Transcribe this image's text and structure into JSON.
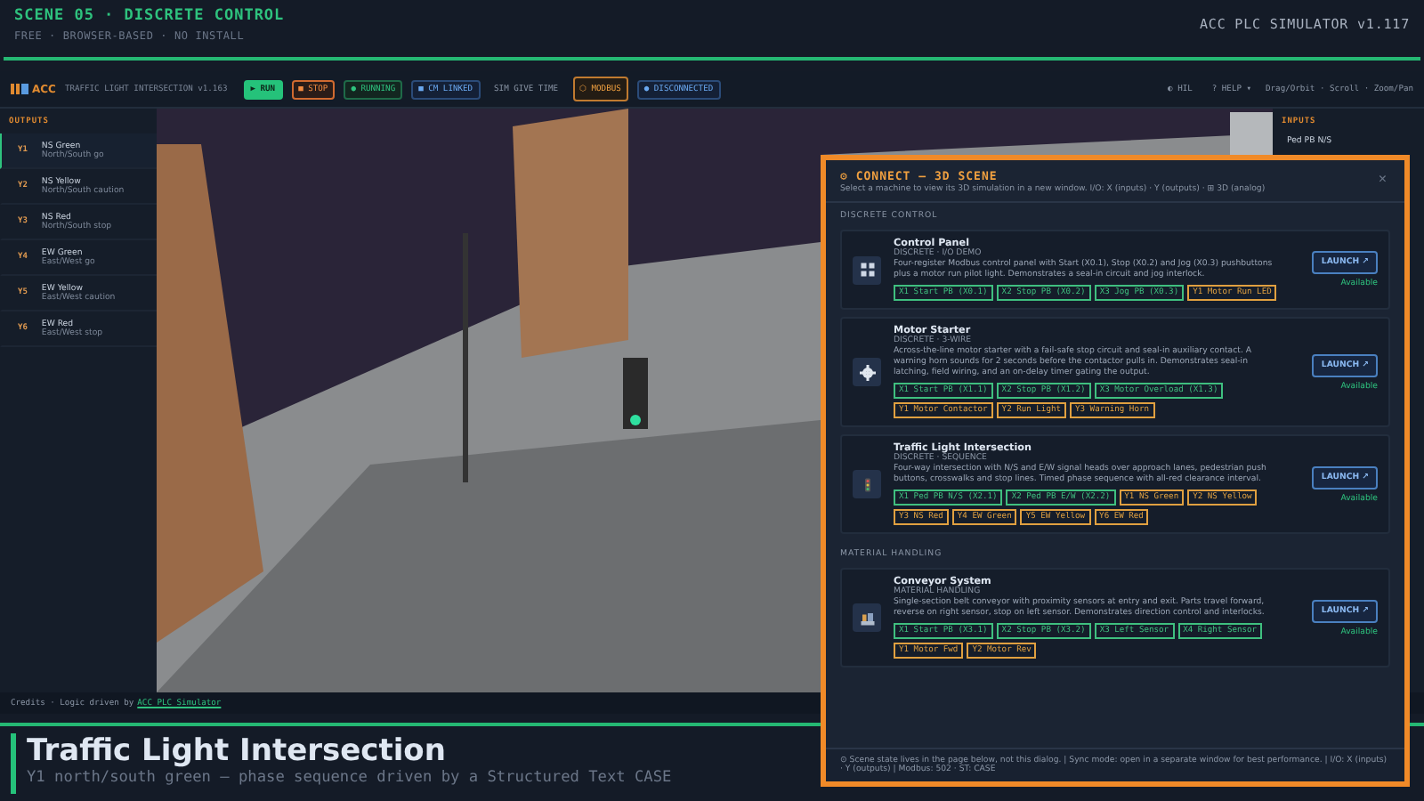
{
  "header": {
    "title": "SCENE 05 · DISCRETE CONTROL",
    "subtitle": "FREE · BROWSER-BASED · NO INSTALL",
    "product": "ACC PLC SIMULATOR  v1.117"
  },
  "toolbar": {
    "logo": "ACC",
    "scene_name": "TRAFFIC LIGHT INTERSECTION v1.163",
    "buttons": [
      {
        "kind": "primary",
        "label": "▶ RUN"
      },
      {
        "kind": "danger",
        "label": "■ STOP"
      },
      {
        "kind": "status",
        "label": "● RUNNING"
      },
      {
        "kind": "link",
        "label": "■ CM LINKED"
      },
      {
        "kind": "plain",
        "label": "SIM GIVE TIME"
      },
      {
        "kind": "warn",
        "label": "⬡ MODBUS"
      },
      {
        "kind": "link",
        "label": "● DISCONNECTED"
      }
    ],
    "right_buttons": [
      {
        "kind": "plain",
        "label": "◐ HIL"
      },
      {
        "kind": "plain",
        "label": "? HELP ▾"
      }
    ],
    "hint": "Drag/Orbit · Scroll · Zoom/Pan"
  },
  "outputs": {
    "title": "OUTPUTS",
    "items": [
      {
        "tag": "Y1",
        "name": "NS Green",
        "note": "North/South go",
        "selected": true
      },
      {
        "tag": "Y2",
        "name": "NS Yellow",
        "note": "North/South caution",
        "selected": false
      },
      {
        "tag": "Y3",
        "name": "NS Red",
        "note": "North/South stop",
        "selected": false
      },
      {
        "tag": "Y4",
        "name": "EW Green",
        "note": "East/West go",
        "selected": false
      },
      {
        "tag": "Y5",
        "name": "EW Yellow",
        "note": "East/West caution",
        "selected": false
      },
      {
        "tag": "Y6",
        "name": "EW Red",
        "note": "East/West stop",
        "selected": false
      }
    ]
  },
  "inputs": {
    "title": "INPUTS",
    "items": [
      "Ped PB N/S"
    ]
  },
  "credits": {
    "text": "Credits · Logic driven by",
    "link": "ACC PLC Simulator"
  },
  "scene_info": {
    "title": "Traffic Light Intersection",
    "subtitle": "Y1 north/south green — phase sequence driven by a Structured Text CASE"
  },
  "dialog": {
    "title": "⚙ CONNECT — 3D SCENE",
    "subtitle": "Select a machine to view its 3D simulation in a new window. I/O: X (inputs) · Y (outputs) · ⊞ 3D (analog)",
    "close": "×",
    "sections": [
      {
        "title": "DISCRETE CONTROL",
        "cards": [
          {
            "kind": "panel",
            "title": "Control Panel",
            "subtitle": "DISCRETE · I/O DEMO",
            "description": "Four-register Modbus control panel with Start (X0.1), Stop (X0.2) and Jog (X0.3) pushbuttons plus a motor run pilot light. Demonstrates a seal-in circuit and jog interlock.",
            "tags": [
              {
                "label": "X1 Start PB (X0.1)",
                "color": "#3fbf7f"
              },
              {
                "label": "X2 Stop PB (X0.2)",
                "color": "#3fbf7f"
              },
              {
                "label": "X3 Jog PB (X0.3)",
                "color": "#3fbf7f"
              },
              {
                "label": "Y1 Motor Run LED",
                "color": "#e0a040"
              }
            ],
            "button": "LAUNCH ↗",
            "status": "Available"
          },
          {
            "kind": "gear",
            "title": "Motor Starter",
            "subtitle": "DISCRETE · 3-WIRE",
            "description": "Across-the-line motor starter with a fail-safe stop circuit and seal-in auxiliary contact. A warning horn sounds for 2 seconds before the contactor pulls in. Demonstrates seal-in latching, field wiring, and an on-delay timer gating the output.",
            "tags": [
              {
                "label": "X1 Start PB (X1.1)",
                "color": "#3fbf7f"
              },
              {
                "label": "X2 Stop PB (X1.2)",
                "color": "#3fbf7f"
              },
              {
                "label": "X3 Motor Overload (X1.3)",
                "color": "#3fbf7f"
              },
              {
                "label": "Y1 Motor Contactor",
                "color": "#e0a040"
              },
              {
                "label": "Y2 Run Light",
                "color": "#e0a040"
              },
              {
                "label": "Y3 Warning Horn",
                "color": "#e0a040"
              }
            ],
            "button": "LAUNCH ↗",
            "status": "Available"
          },
          {
            "kind": "light",
            "title": "Traffic Light Intersection",
            "subtitle": "DISCRETE · SEQUENCE",
            "description": "Four-way intersection with N/S and E/W signal heads over approach lanes, pedestrian push buttons, crosswalks and stop lines. Timed phase sequence with all-red clearance interval.",
            "tags": [
              {
                "label": "X1 Ped PB N/S (X2.1)",
                "color": "#3fbf7f"
              },
              {
                "label": "X2 Ped PB E/W (X2.2)",
                "color": "#3fbf7f"
              },
              {
                "label": "Y1 NS Green",
                "color": "#e0a040"
              },
              {
                "label": "Y2 NS Yellow",
                "color": "#e0a040"
              },
              {
                "label": "Y3 NS Red",
                "color": "#e0a040"
              },
              {
                "label": "Y4 EW Green",
                "color": "#e0a040"
              },
              {
                "label": "Y5 EW Yellow",
                "color": "#e0a040"
              },
              {
                "label": "Y6 EW Red",
                "color": "#e0a040"
              }
            ],
            "button": "LAUNCH ↗",
            "status": "Available"
          }
        ]
      },
      {
        "title": "MATERIAL HANDLING",
        "cards": [
          {
            "kind": "conveyor",
            "title": "Conveyor System",
            "subtitle": "MATERIAL HANDLING",
            "description": "Single-section belt conveyor with proximity sensors at entry and exit. Parts travel forward, reverse on right sensor, stop on left sensor. Demonstrates direction control and interlocks.",
            "tags": [
              {
                "label": "X1 Start PB (X3.1)",
                "color": "#3fbf7f"
              },
              {
                "label": "X2 Stop PB (X3.2)",
                "color": "#3fbf7f"
              },
              {
                "label": "X3 Left Sensor",
                "color": "#3fbf7f"
              },
              {
                "label": "X4 Right Sensor",
                "color": "#3fbf7f"
              },
              {
                "label": "Y1 Motor Fwd",
                "color": "#e0a040"
              },
              {
                "label": "Y2 Motor Rev",
                "color": "#e0a040"
              }
            ],
            "button": "LAUNCH ↗",
            "status": "Available"
          }
        ]
      }
    ],
    "footer": "⊙ Scene state lives in the page below, not this dialog. | Sync mode: open in a separate window for best performance. | I/O: X (inputs) · Y (outputs) | Modbus: 502 · ST: CASE"
  }
}
